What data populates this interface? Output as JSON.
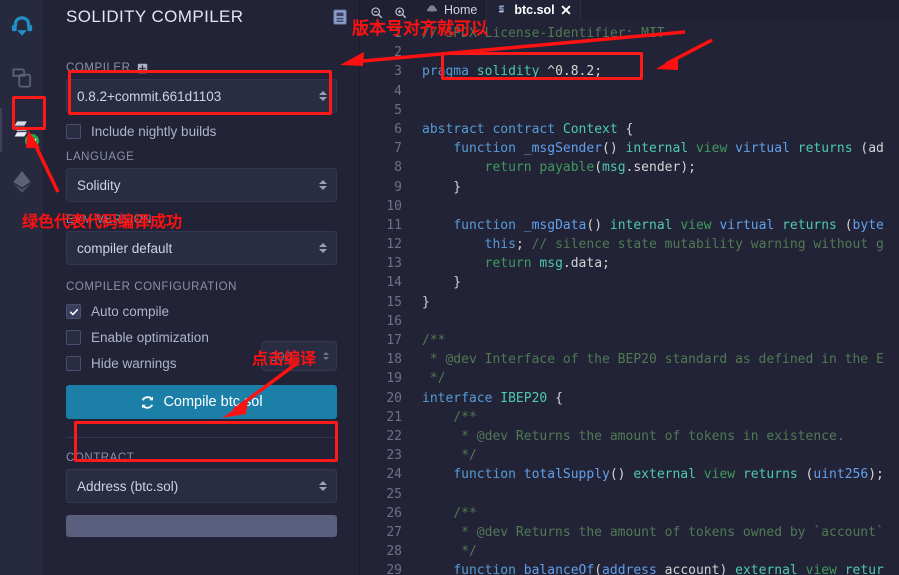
{
  "rail": {
    "items": [
      {
        "name": "remix-logo",
        "label": "Remix"
      },
      {
        "name": "file-explorers-icon",
        "label": "File explorers"
      },
      {
        "name": "solidity-compiler-icon",
        "label": "Solidity compiler"
      },
      {
        "name": "deploy-run-icon",
        "label": "Deploy & run transactions"
      }
    ]
  },
  "panel": {
    "title": "SOLIDITY COMPILER",
    "header_icon": "document-icon",
    "compiler_label": "COMPILER",
    "compiler_label_icon": "compiler-settings-icon",
    "compiler_version": "0.8.2+commit.661d1103",
    "nightly_label": "Include nightly builds",
    "nightly_checked": false,
    "language_label": "LANGUAGE",
    "language_value": "Solidity",
    "evm_label": "EVM VERSION",
    "evm_value": "compiler default",
    "config_label": "COMPILER CONFIGURATION",
    "auto_compile_label": "Auto compile",
    "auto_compile_checked": true,
    "enable_optimization_label": "Enable optimization",
    "enable_optimization_checked": false,
    "optimization_runs": "200",
    "hide_warnings_label": "Hide warnings",
    "hide_warnings_checked": false,
    "compile_button_label": "Compile btc.sol",
    "compile_button_icon": "refresh-icon",
    "compile_button_color": "#1b7fa8",
    "contract_label": "CONTRACT",
    "contract_value": "Address (btc.sol)"
  },
  "editor": {
    "zoom_out_icon": "zoom-out-icon",
    "zoom_in_icon": "zoom-in-icon",
    "tabs": [
      {
        "label": "Home",
        "icon": "home-icon",
        "active": false,
        "closable": false
      },
      {
        "label": "btc.sol",
        "icon": "solidity-file-icon",
        "active": true,
        "closable": true,
        "close_icon": "close-icon"
      }
    ],
    "first_line_number": 1,
    "lines": [
      {
        "n": 1,
        "tokens": [
          {
            "t": "// SPDX-License-Identifier: MIT",
            "c": "c-com"
          }
        ]
      },
      {
        "n": 2,
        "tokens": []
      },
      {
        "n": 3,
        "tokens": [
          {
            "t": "pragma",
            "c": "c-kw"
          },
          {
            "t": " ",
            "c": "c-txt"
          },
          {
            "t": "solidity",
            "c": "c-kw2"
          },
          {
            "t": " ^0.8.2;",
            "c": "c-txt"
          }
        ]
      },
      {
        "n": 4,
        "tokens": []
      },
      {
        "n": 5,
        "tokens": []
      },
      {
        "n": 6,
        "tokens": [
          {
            "t": "abstract",
            "c": "c-kw"
          },
          {
            "t": " ",
            "c": "c-txt"
          },
          {
            "t": "contract",
            "c": "c-kw"
          },
          {
            "t": " ",
            "c": "c-txt"
          },
          {
            "t": "Context",
            "c": "c-type"
          },
          {
            "t": " {",
            "c": "c-txt"
          }
        ]
      },
      {
        "n": 7,
        "tokens": [
          {
            "t": "    ",
            "c": "c-txt"
          },
          {
            "t": "function",
            "c": "c-kw"
          },
          {
            "t": " ",
            "c": "c-txt"
          },
          {
            "t": "_msgSender",
            "c": "c-fn"
          },
          {
            "t": "() ",
            "c": "c-txt"
          },
          {
            "t": "internal",
            "c": "c-kw2"
          },
          {
            "t": " ",
            "c": "c-txt"
          },
          {
            "t": "view",
            "c": "c-ret"
          },
          {
            "t": " ",
            "c": "c-txt"
          },
          {
            "t": "virtual",
            "c": "c-fn"
          },
          {
            "t": " ",
            "c": "c-txt"
          },
          {
            "t": "returns",
            "c": "c-kw2"
          },
          {
            "t": " (ad",
            "c": "c-txt"
          }
        ]
      },
      {
        "n": 8,
        "tokens": [
          {
            "t": "        ",
            "c": "c-txt"
          },
          {
            "t": "return",
            "c": "c-ret"
          },
          {
            "t": " ",
            "c": "c-txt"
          },
          {
            "t": "payable",
            "c": "c-ret"
          },
          {
            "t": "(",
            "c": "c-txt"
          },
          {
            "t": "msg",
            "c": "c-var"
          },
          {
            "t": ".sender);",
            "c": "c-txt"
          }
        ]
      },
      {
        "n": 9,
        "tokens": [
          {
            "t": "    }",
            "c": "c-txt"
          }
        ]
      },
      {
        "n": 10,
        "tokens": []
      },
      {
        "n": 11,
        "tokens": [
          {
            "t": "    ",
            "c": "c-txt"
          },
          {
            "t": "function",
            "c": "c-kw"
          },
          {
            "t": " ",
            "c": "c-txt"
          },
          {
            "t": "_msgData",
            "c": "c-fn"
          },
          {
            "t": "() ",
            "c": "c-txt"
          },
          {
            "t": "internal",
            "c": "c-kw2"
          },
          {
            "t": " ",
            "c": "c-txt"
          },
          {
            "t": "view",
            "c": "c-ret"
          },
          {
            "t": " ",
            "c": "c-txt"
          },
          {
            "t": "virtual",
            "c": "c-fn"
          },
          {
            "t": " ",
            "c": "c-txt"
          },
          {
            "t": "returns",
            "c": "c-kw2"
          },
          {
            "t": " (",
            "c": "c-txt"
          },
          {
            "t": "byte",
            "c": "c-fn"
          }
        ]
      },
      {
        "n": 12,
        "tokens": [
          {
            "t": "        ",
            "c": "c-txt"
          },
          {
            "t": "this",
            "c": "c-kw"
          },
          {
            "t": "; ",
            "c": "c-txt"
          },
          {
            "t": "// silence state mutability warning without g",
            "c": "c-com"
          }
        ]
      },
      {
        "n": 13,
        "tokens": [
          {
            "t": "        ",
            "c": "c-txt"
          },
          {
            "t": "return",
            "c": "c-ret"
          },
          {
            "t": " ",
            "c": "c-txt"
          },
          {
            "t": "msg",
            "c": "c-var"
          },
          {
            "t": ".data;",
            "c": "c-txt"
          }
        ]
      },
      {
        "n": 14,
        "tokens": [
          {
            "t": "    }",
            "c": "c-txt"
          }
        ]
      },
      {
        "n": 15,
        "tokens": [
          {
            "t": "}",
            "c": "c-txt"
          }
        ]
      },
      {
        "n": 16,
        "tokens": []
      },
      {
        "n": 17,
        "tokens": [
          {
            "t": "/**",
            "c": "c-com"
          }
        ]
      },
      {
        "n": 18,
        "tokens": [
          {
            "t": " * @dev Interface of the BEP20 standard as defined in the E",
            "c": "c-com"
          }
        ]
      },
      {
        "n": 19,
        "tokens": [
          {
            "t": " */",
            "c": "c-com"
          }
        ]
      },
      {
        "n": 20,
        "tokens": [
          {
            "t": "interface",
            "c": "c-kw"
          },
          {
            "t": " ",
            "c": "c-txt"
          },
          {
            "t": "IBEP20",
            "c": "c-type"
          },
          {
            "t": " {",
            "c": "c-txt"
          }
        ]
      },
      {
        "n": 21,
        "tokens": [
          {
            "t": "    /**",
            "c": "c-com"
          }
        ]
      },
      {
        "n": 22,
        "tokens": [
          {
            "t": "     * @dev Returns the amount of tokens in existence.",
            "c": "c-com"
          }
        ]
      },
      {
        "n": 23,
        "tokens": [
          {
            "t": "     */",
            "c": "c-com"
          }
        ]
      },
      {
        "n": 24,
        "tokens": [
          {
            "t": "    ",
            "c": "c-txt"
          },
          {
            "t": "function",
            "c": "c-kw"
          },
          {
            "t": " ",
            "c": "c-txt"
          },
          {
            "t": "totalSupply",
            "c": "c-fn"
          },
          {
            "t": "() ",
            "c": "c-txt"
          },
          {
            "t": "external",
            "c": "c-kw2"
          },
          {
            "t": " ",
            "c": "c-txt"
          },
          {
            "t": "view",
            "c": "c-ret"
          },
          {
            "t": " ",
            "c": "c-txt"
          },
          {
            "t": "returns",
            "c": "c-kw2"
          },
          {
            "t": " (",
            "c": "c-txt"
          },
          {
            "t": "uint256",
            "c": "c-fn"
          },
          {
            "t": ");",
            "c": "c-txt"
          }
        ]
      },
      {
        "n": 25,
        "tokens": []
      },
      {
        "n": 26,
        "tokens": [
          {
            "t": "    /**",
            "c": "c-com"
          }
        ]
      },
      {
        "n": 27,
        "tokens": [
          {
            "t": "     * @dev Returns the amount of tokens owned by `account`",
            "c": "c-com"
          }
        ]
      },
      {
        "n": 28,
        "tokens": [
          {
            "t": "     */",
            "c": "c-com"
          }
        ]
      },
      {
        "n": 29,
        "tokens": [
          {
            "t": "    ",
            "c": "c-txt"
          },
          {
            "t": "function",
            "c": "c-kw"
          },
          {
            "t": " ",
            "c": "c-txt"
          },
          {
            "t": "balanceOf",
            "c": "c-fn"
          },
          {
            "t": "(",
            "c": "c-txt"
          },
          {
            "t": "address",
            "c": "c-fn"
          },
          {
            "t": " account) ",
            "c": "c-txt"
          },
          {
            "t": "external",
            "c": "c-kw2"
          },
          {
            "t": " ",
            "c": "c-txt"
          },
          {
            "t": "view",
            "c": "c-ret"
          },
          {
            "t": " ",
            "c": "c-txt"
          },
          {
            "t": "retur",
            "c": "c-kw2"
          }
        ]
      }
    ]
  },
  "annotations": {
    "color": "#ff1111",
    "version_note": "版本号对齐就可以",
    "green_note": "绿色代表代码编译成功",
    "click_compile_note": "点击编译"
  }
}
